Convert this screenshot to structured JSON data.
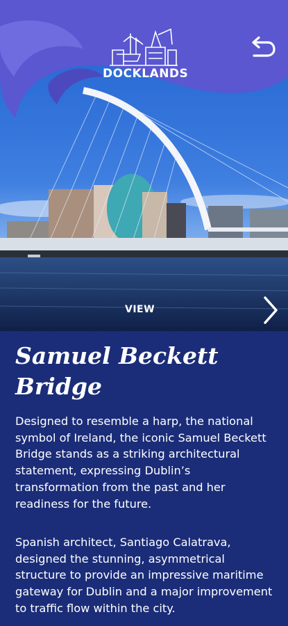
{
  "header": {
    "logo_text": "DOCKLANDS",
    "back_icon": "undo-arrow-icon"
  },
  "hero": {
    "view_label": "VIEW",
    "next_icon": "chevron-right-icon"
  },
  "article": {
    "title_line1": "Samuel Beckett",
    "title_line2": "Bridge",
    "paragraph1": "Designed to resemble a harp, the national symbol of Ireland, the iconic Samuel Beckett Bridge stands as a striking architectural statement, expressing Dublin’s transformation from the past and her readiness for the future.",
    "paragraph2": "Spanish architect, Santiago Calatrava, designed the stunning, asymmetrical structure to provide an impressive maritime gateway for Dublin and a major improvement to traffic flow within the city."
  },
  "colors": {
    "header_wave": "#5a57d0",
    "content_bg": "#1b2d78"
  }
}
